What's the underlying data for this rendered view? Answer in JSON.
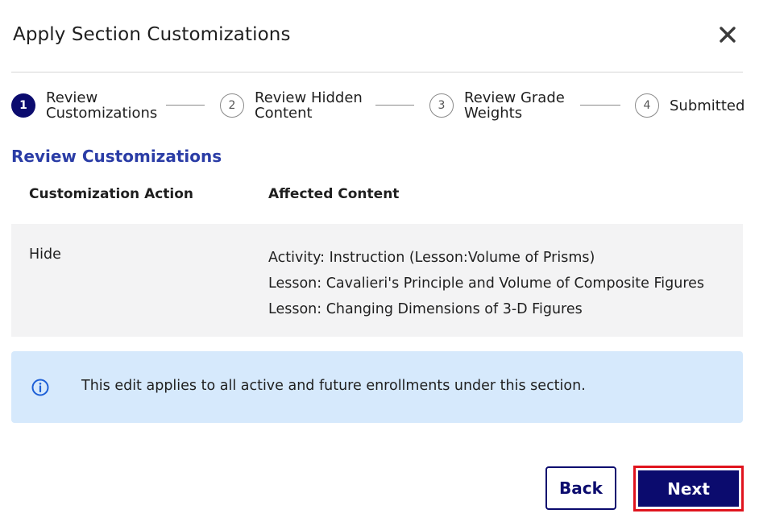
{
  "dialog": {
    "title": "Apply Section Customizations",
    "close_icon": "close-icon"
  },
  "stepper": {
    "steps": [
      {
        "number": "1",
        "label_line1": "Review",
        "label_line2": "Customizations",
        "state": "active"
      },
      {
        "number": "2",
        "label_line1": "Review Hidden",
        "label_line2": "Content",
        "state": "inactive"
      },
      {
        "number": "3",
        "label_line1": "Review Grade",
        "label_line2": "Weights",
        "state": "inactive"
      },
      {
        "number": "4",
        "label_line1": "Submitted",
        "label_line2": "",
        "state": "inactive"
      }
    ]
  },
  "section": {
    "heading": "Review Customizations"
  },
  "table": {
    "headers": [
      "Customization Action",
      "Affected Content"
    ],
    "rows": [
      {
        "action": "Hide",
        "content": [
          "Activity:  Instruction (Lesson:Volume of Prisms)",
          "Lesson:  Cavalieri's Principle and Volume of Composite Figures",
          "Lesson:  Changing Dimensions of 3-D Figures"
        ]
      }
    ]
  },
  "info": {
    "icon": "info-icon",
    "text": "This edit applies to all active and future enrollments under this section."
  },
  "actions": {
    "back_label": "Back",
    "next_label": "Next"
  },
  "colors": {
    "primary": "#0b0b6e",
    "heading": "#2b3da6",
    "info_bg": "#d6e9fc",
    "highlight": "#e0141e"
  }
}
